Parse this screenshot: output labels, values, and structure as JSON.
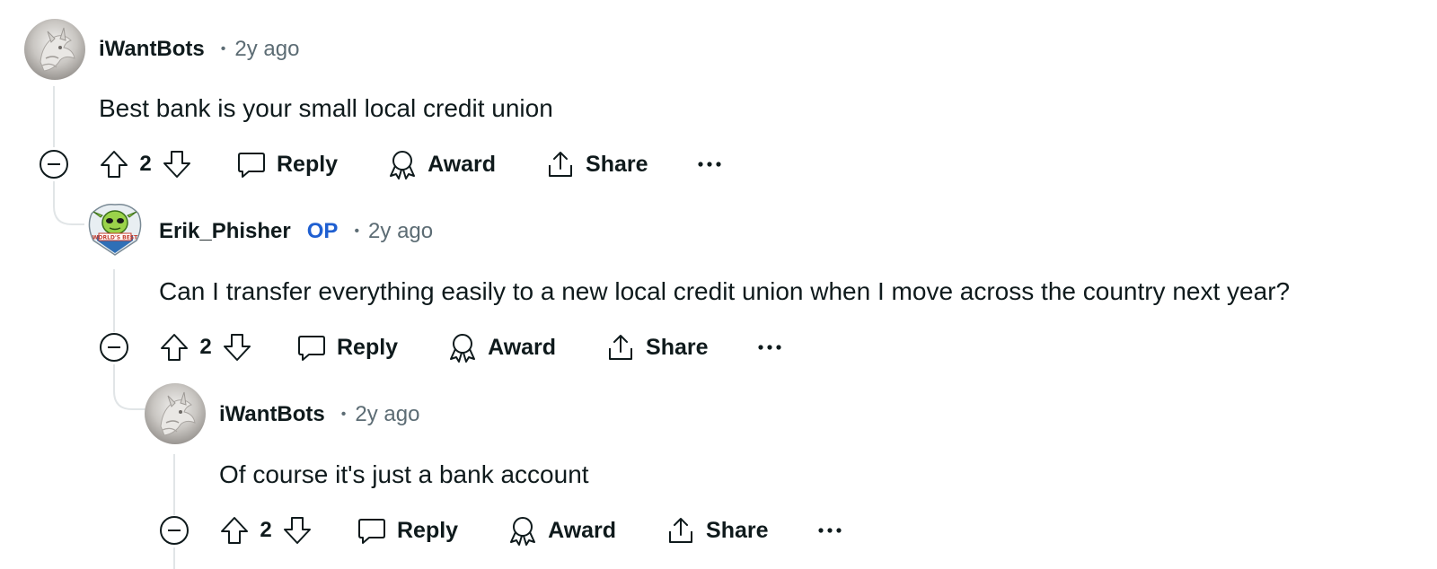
{
  "comments": [
    {
      "author": "iWantBots",
      "is_op": false,
      "dot": "•",
      "time": "2y ago",
      "body": "Best bank is your small local credit union",
      "score": "2",
      "avatar": "stone-dragon-avatar"
    },
    {
      "author": "Erik_Phisher",
      "is_op": true,
      "op_label": "OP",
      "dot": "•",
      "time": "2y ago",
      "body": "Can I transfer everything easily to a new local credit union when I move across the country next year?",
      "score": "2",
      "avatar": "worlds-best-badge-avatar",
      "avatar_text": "WORLD'S BEST"
    },
    {
      "author": "iWantBots",
      "is_op": false,
      "dot": "•",
      "time": "2y ago",
      "body": "Of course it's just a bank account",
      "score": "2",
      "avatar": "stone-dragon-avatar"
    }
  ],
  "actions": {
    "reply": "Reply",
    "award": "Award",
    "share": "Share"
  },
  "icons": {
    "collapse": "minus-circle-icon",
    "upvote": "upvote-arrow-icon",
    "downvote": "downvote-arrow-icon",
    "reply": "speech-bubble-icon",
    "award": "award-ribbon-icon",
    "share": "share-upload-icon",
    "more": "ellipsis-icon"
  },
  "colors": {
    "text": "#0f1a1c",
    "meta": "#5c6c74",
    "op": "#1f5fd1",
    "thread_line": "#e0e4e6"
  }
}
